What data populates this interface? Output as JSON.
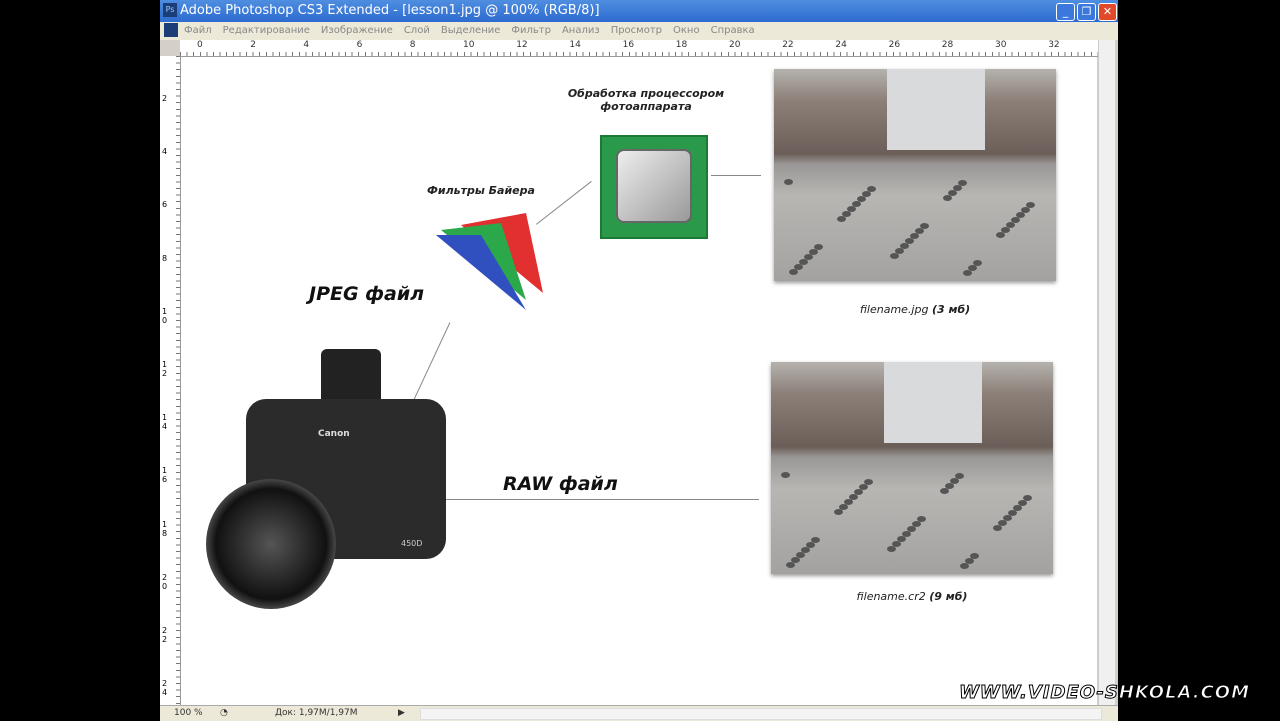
{
  "window": {
    "title": "Adobe Photoshop CS3 Extended - [lesson1.jpg @ 100% (RGB/8)]",
    "app_icon": "Ps"
  },
  "menu": [
    "Файл",
    "Редактирование",
    "Изображение",
    "Слой",
    "Выделение",
    "Фильтр",
    "Анализ",
    "Просмотр",
    "Окно",
    "Справка"
  ],
  "ruler_top": [
    "0",
    "2",
    "4",
    "6",
    "8",
    "10",
    "12",
    "14",
    "16",
    "18",
    "20",
    "22",
    "24",
    "26",
    "28",
    "30",
    "32"
  ],
  "ruler_left": [
    "2",
    "4",
    "6",
    "8",
    "1 0",
    "1 2",
    "1 4",
    "1 6",
    "1 8",
    "2 0",
    "2 2",
    "2 4"
  ],
  "canvas": {
    "processor_label": "Обработка процессором фотоаппарата",
    "bayer_label": "Фильтры Байера",
    "jpeg_label": "JPEG файл",
    "raw_label": "RAW файл",
    "jpg_caption_name": "filename.jpg",
    "jpg_caption_size": "(3 мб)",
    "raw_caption_name": "filename.cr2",
    "raw_caption_size": "(9 мб)",
    "camera_brand": "Canon",
    "camera_model": "450D"
  },
  "status": {
    "zoom": "100 %",
    "doc": "Док: 1,97M/1,97M"
  },
  "watermark": "WWW.VIDEO-SHKOLA.COM"
}
